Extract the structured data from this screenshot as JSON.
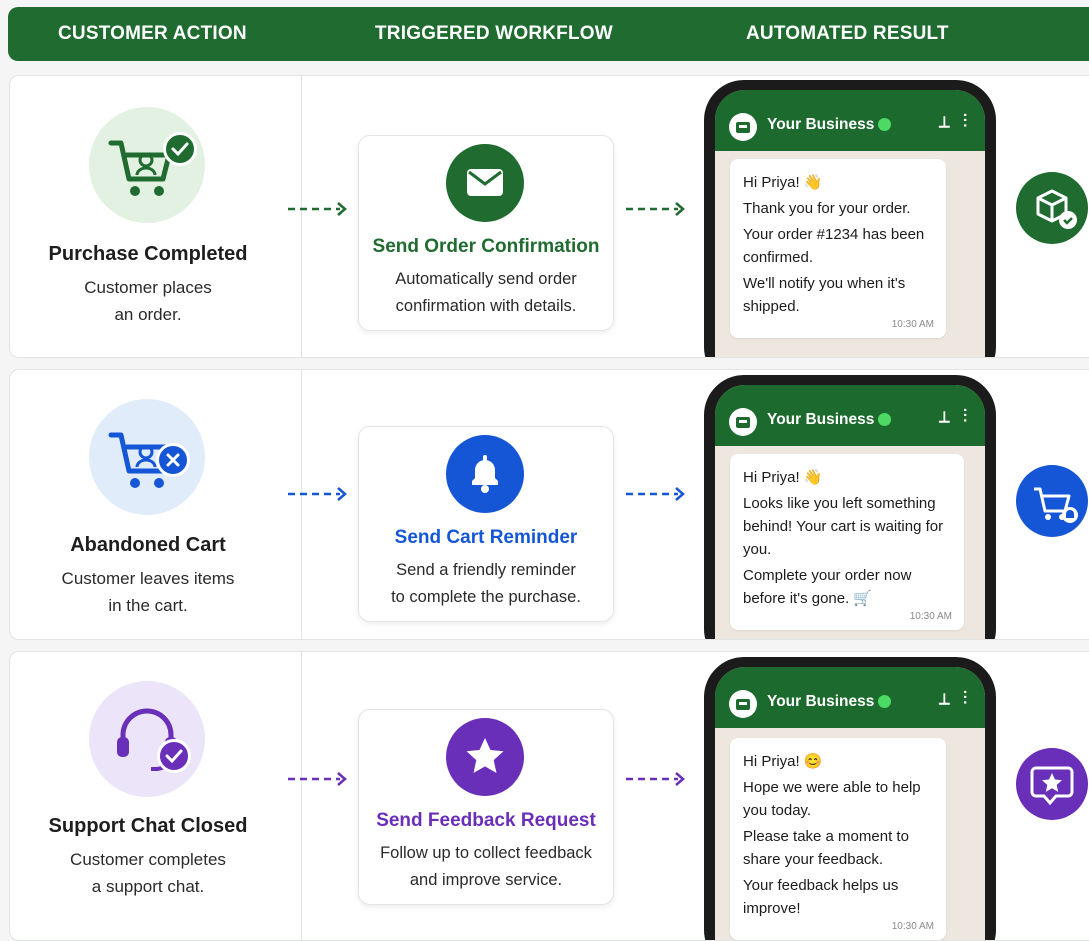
{
  "header": {
    "col1": "CUSTOMER ACTION",
    "col2": "TRIGGERED WORKFLOW",
    "col3": "AUTOMATED RESULT"
  },
  "colors": {
    "green": "#1f6b30",
    "blue": "#1456d6",
    "purple": "#6a2fb8"
  },
  "rows": [
    {
      "icon": "shopping-cart-check-icon",
      "title": "Purchase Completed",
      "desc_line1": "Customer places",
      "desc_line2": "an order.",
      "workflow_icon": "envelope-icon",
      "workflow_title": "Send Order Confirmation",
      "workflow_desc_line1": "Automatically send order",
      "workflow_desc_line2": "confirmation with details.",
      "business": "Your Business",
      "messages": [
        "Hi Priya! 👋",
        "Thank you for your order.",
        "Your order #1234 has been confirmed.",
        "We'll notify you when it's shipped."
      ],
      "time": "10:30 AM",
      "result_icon": "package-check-icon"
    },
    {
      "icon": "shopping-cart-x-icon",
      "title": "Abandoned Cart",
      "desc_line1": "Customer leaves items",
      "desc_line2": "in the cart.",
      "workflow_icon": "bell-icon",
      "workflow_title": "Send Cart Reminder",
      "workflow_desc_line1": "Send a friendly reminder",
      "workflow_desc_line2": "to complete the purchase.",
      "business": "Your Business",
      "messages": [
        "Hi Priya! 👋",
        "Looks like you left something behind! Your cart is waiting for you.",
        "Complete your order now before it's gone. 🛒"
      ],
      "time": "10:30 AM",
      "result_icon": "cart-bell-icon"
    },
    {
      "icon": "headset-check-icon",
      "title": "Support Chat Closed",
      "desc_line1": "Customer completes",
      "desc_line2": "a support chat.",
      "workflow_icon": "star-icon",
      "workflow_title": "Send Feedback Request",
      "workflow_desc_line1": "Follow up to collect feedback",
      "workflow_desc_line2": "and improve service.",
      "business": "Your Business",
      "messages": [
        "Hi Priya! 😊",
        "Hope we were able to help you today.",
        "Please take a moment to share your feedback.",
        "Your feedback helps us improve!"
      ],
      "time": "10:30 AM",
      "result_icon": "star-chat-icon"
    }
  ]
}
